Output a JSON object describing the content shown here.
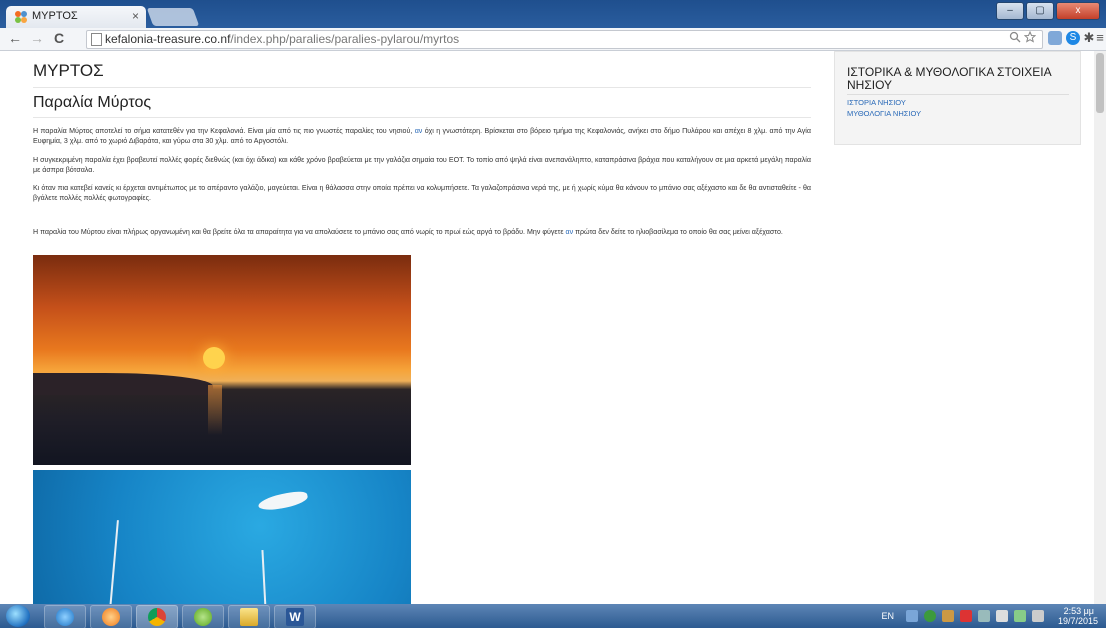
{
  "browser": {
    "tab_title": "ΜΥΡΤΟΣ",
    "tab_close": "×",
    "url_host": "kefalonia-treasure.co.nf",
    "url_path": "/index.php/paralies/paralies-pylarou/myrtos",
    "window_buttons": {
      "minimize": "–",
      "maximize": "▢",
      "close": "x"
    },
    "nav": {
      "back": "←",
      "forward": "→",
      "reload": "C"
    }
  },
  "page": {
    "title": "ΜΥΡΤΟΣ",
    "article_title": "Παραλία Μύρτος",
    "paragraphs": {
      "p1_a": "Η παραλία Μύρτος αποτελεί το σήμα κατατεθέν για την Κεφαλονιά. Είναι μία από τις πιο γνωστές παραλίες του νησιού, ",
      "p1_link": "αν",
      "p1_b": " όχι η γνωστότερη. Βρίσκεται στο βόρειο τμήμα της Κεφαλονιάς, ανήκει στο δήμο Πυλάρου και απέχει 8 χλμ. από την Αγία Ευφημία, 3 χλμ. από το χωριό Διβαράτα, και γύρω στα 30 χλμ. από το Αργοστόλι.",
      "p2": "Η συγκεκριμένη παραλία έχει βραβευτεί πολλές φορές διεθνώς (και όχι άδικα) και κάθε χρόνο βραβεύεται με την γαλάζια σημαία του ΕΟΤ. Το τοπίο από ψηλά είναι ανεπανάληπτο, καταπράσινα βράχια που καταλήγουν σε μια αρκετά μεγάλη παραλία με άσπρα βότσαλα.",
      "p3": "Κι όταν πια κατεβεί κανείς κι έρχεται αντιμέτωπος με το απέραντο γαλάζιο, μαγεύεται. Είναι η θάλασσα στην οποία πρέπει να κολυμπήσετε. Τα γαλαζοπράσινα νερά της, με ή χωρίς κύμα θα κάνουν το μπάνιο σας αξέχαστο και δε θα αντισταθείτε - θα βγάλετε πολλές πολλές φωτογραφίες.",
      "p4_a": "Η παραλία του Μύρτου είναι πλήρως οργανωμένη και θα βρείτε όλα τα απαραίτητα για να απολαύσετε το μπάνιο σας από νωρίς το πρωί εώς αργά το βράδυ. Μην φύγετε ",
      "p4_link": "αν",
      "p4_b": " πρώτα δεν δείτε το ηλιοβασίλεμα το οποίο θα σας μείνει αξέχαστο."
    }
  },
  "sidebar": {
    "title": "ΙΣΤΟΡΙΚΑ & ΜΥΘΟΛΟΓΙΚΑ ΣΤΟΙΧΕΙΑ ΝΗΣΙΟΥ",
    "links": [
      "ΙΣΤΟΡΙΑ ΝΗΣΙΟΥ",
      "ΜΥΘΟΛΟΓΙΑ ΝΗΣΙΟΥ"
    ]
  },
  "taskbar": {
    "lang": "EN",
    "time": "2:53 μμ",
    "date": "19/7/2015",
    "word_label": "W"
  },
  "colors": {
    "link": "#2a6ab8",
    "titlebar": "#1f4f8e",
    "taskbar": "#2c5a90"
  }
}
